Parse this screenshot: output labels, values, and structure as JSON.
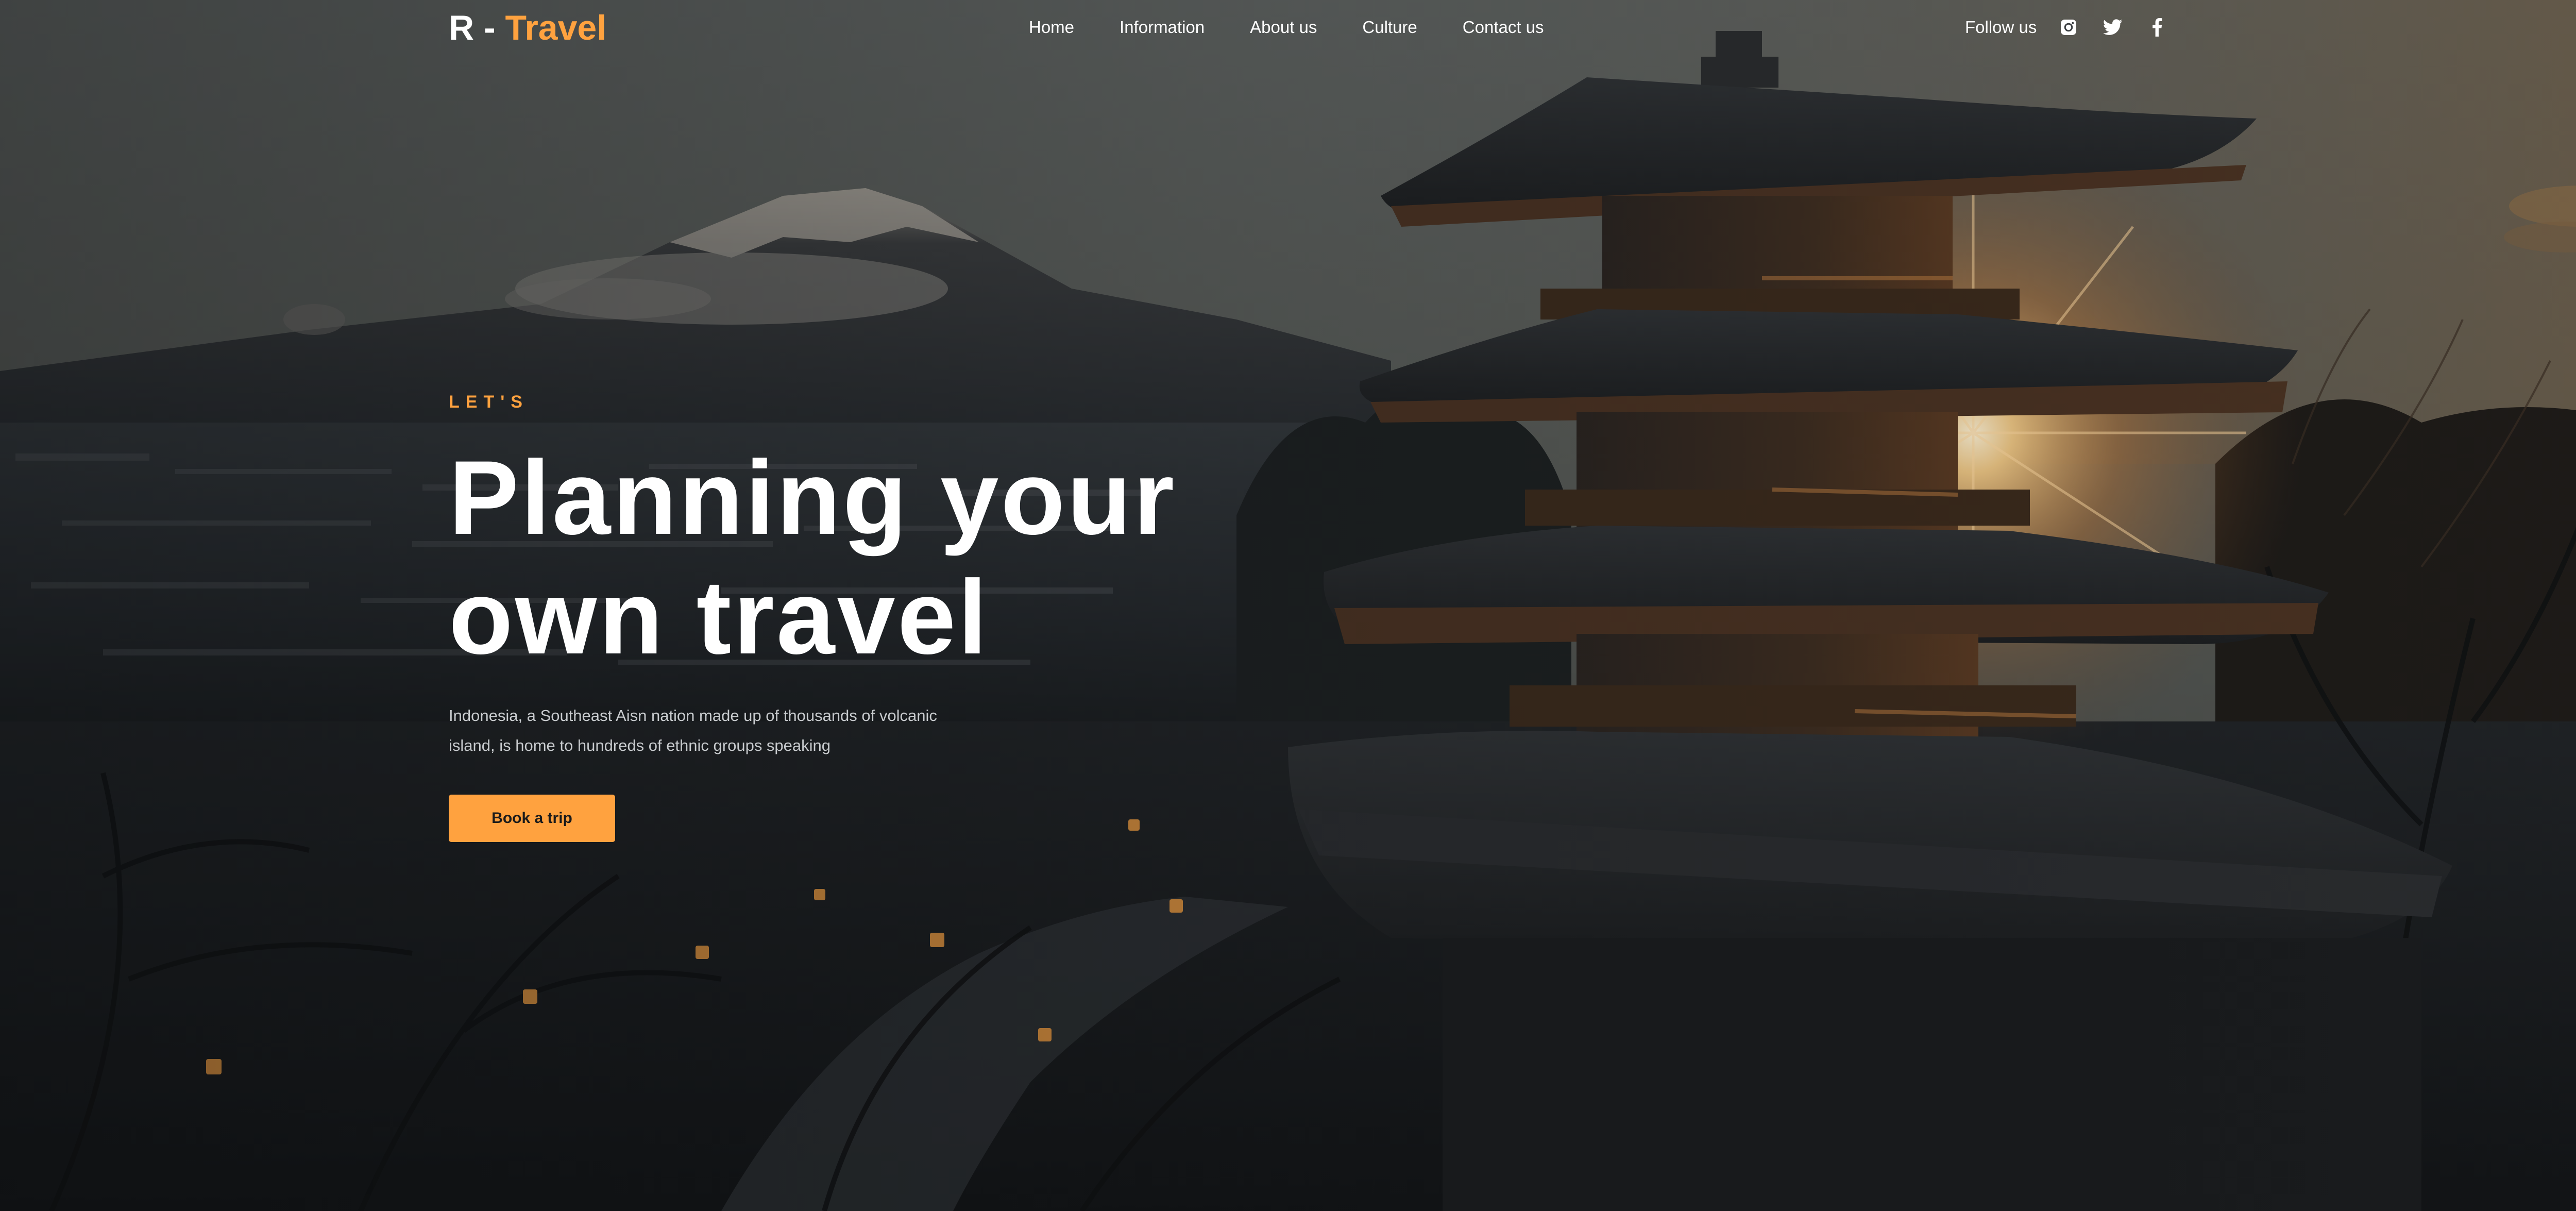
{
  "header": {
    "logo_prefix": "R - ",
    "logo_accent": "Travel",
    "nav": [
      {
        "label": "Home"
      },
      {
        "label": "Information"
      },
      {
        "label": "About us"
      },
      {
        "label": "Culture"
      },
      {
        "label": "Contact us"
      }
    ],
    "follow_label": "Follow us",
    "social_icons": [
      "instagram-icon",
      "twitter-icon",
      "facebook-icon"
    ]
  },
  "hero": {
    "eyebrow": "LET'S",
    "title_line1": "Planning your",
    "title_line2": "own travel",
    "description": "Indonesia, a Southeast Aisn nation made up of thousands of volcanic island, is home to hundreds of ethnic groups speaking",
    "cta_label": "Book a trip"
  },
  "colors": {
    "accent": "#ffa23f",
    "text": "#ffffff",
    "muted_text": "#c8cbce",
    "background": "#1a1d20"
  }
}
